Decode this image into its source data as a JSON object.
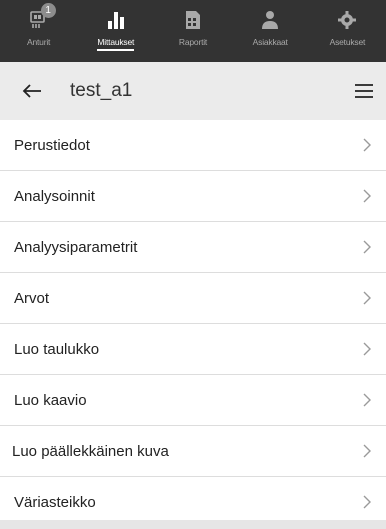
{
  "tabs": [
    {
      "label": "Anturit",
      "icon": "sensor-icon",
      "badge": "1"
    },
    {
      "label": "Mittaukset",
      "icon": "bar-chart-icon",
      "active": true
    },
    {
      "label": "Raportit",
      "icon": "report-icon"
    },
    {
      "label": "Asiakkaat",
      "icon": "customers-icon"
    },
    {
      "label": "Asetukset",
      "icon": "settings-gear-icon"
    }
  ],
  "header": {
    "title": "test_a1",
    "back_icon": "arrow-left-icon",
    "menu_icon": "hamburger-menu-icon"
  },
  "menu_items": [
    {
      "label": "Perustiedot"
    },
    {
      "label": "Analysoinnit"
    },
    {
      "label": "Analyysiparametrit"
    },
    {
      "label": "Arvot"
    },
    {
      "label": "Luo taulukko"
    },
    {
      "label": "Luo kaavio"
    },
    {
      "label": "Luo päällekkäinen kuva"
    },
    {
      "label": "Väriasteikko"
    }
  ],
  "colors": {
    "tabbar_bg": "#333333",
    "header_bg": "#ebebeb",
    "divider": "#dddddd",
    "chevron": "#9a9a9a"
  }
}
